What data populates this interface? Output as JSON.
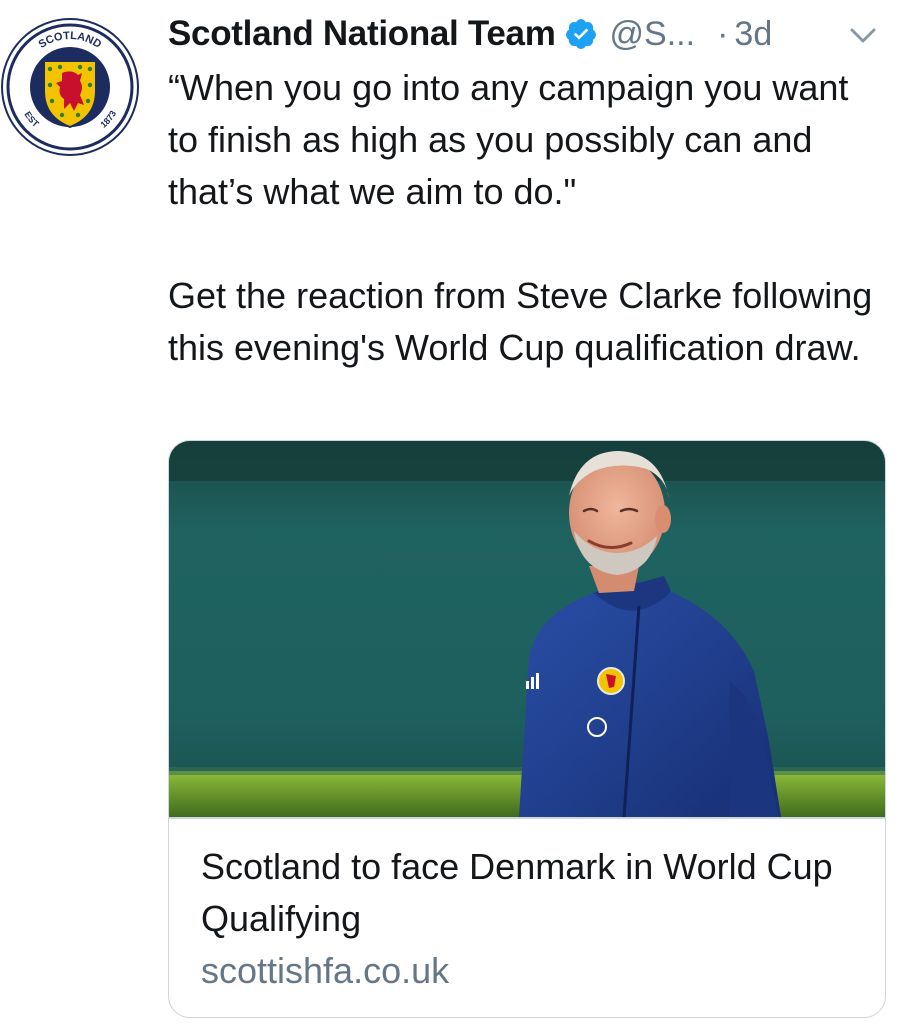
{
  "tweet": {
    "display_name": "Scotland National Team",
    "handle": "@S...",
    "separator": "·",
    "time": "3d",
    "verified": true,
    "text_paragraph_1": "“When you go into any campaign you want to finish as high as you possibly can and that’s what we aim to do.\"",
    "text_paragraph_2": "Get the reaction from Steve Clarke following this evening's World Cup qualification draw."
  },
  "avatar": {
    "badge_top_text": "SCOTLAND",
    "badge_left_text": "EST",
    "badge_right_text": "1873",
    "icon": "scotland-fa-crest"
  },
  "card": {
    "title": "Scotland to face Denmark in World Cup Qualifying",
    "domain": "scottishfa.co.uk",
    "image_subject": "man-in-navy-training-jacket-photo"
  },
  "colors": {
    "text_primary": "#14171a",
    "text_secondary": "#657786",
    "verified_blue": "#1da1f2",
    "card_border": "#ccd6dd",
    "badge_navy": "#1d2c5e",
    "badge_gold": "#f3c300",
    "lion_red": "#c8102e"
  }
}
